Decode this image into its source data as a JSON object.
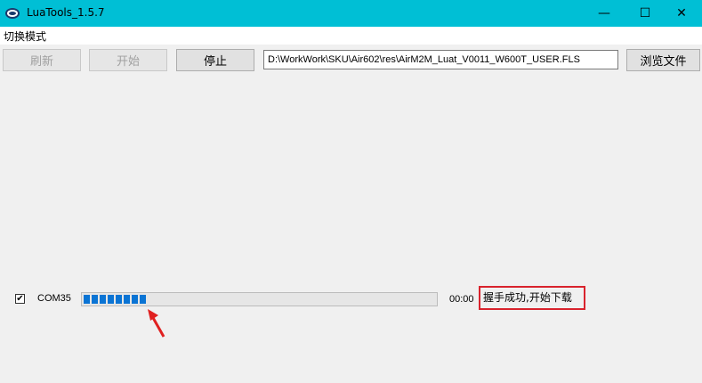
{
  "window": {
    "title": "LuaTools_1.5.7",
    "minimize_glyph": "—",
    "maximize_glyph": "☐",
    "close_glyph": "✕",
    "titlebar_color": "#00bfd5"
  },
  "menubar": {
    "items": [
      {
        "label": "切换模式"
      }
    ]
  },
  "toolbar": {
    "refresh_label": "刷新",
    "start_label": "开始",
    "stop_label": "停止",
    "file_path": "D:\\WorkWork\\SKU\\Air602\\res\\AirM2M_Luat_V0011_W600T_USER.FLS",
    "browse_label": "浏览文件"
  },
  "device": {
    "checked": true,
    "check_glyph": "✔",
    "port": "COM35",
    "progress_percent": 18,
    "elapsed": "00:00",
    "status": "握手成功,开始下载",
    "status_border_color": "#d9232d",
    "progress_color": "#0a74d4"
  },
  "annotation": {
    "arrow_color": "#e02020"
  }
}
